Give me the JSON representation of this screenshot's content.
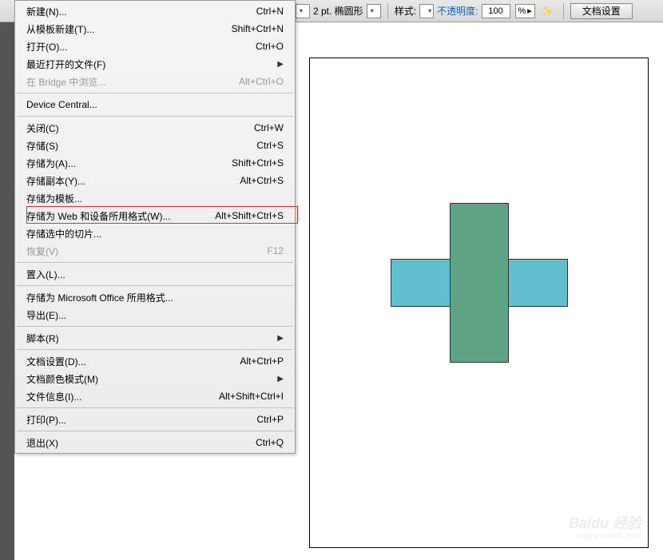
{
  "toolbar": {
    "stroke_val": "2 pt. 椭圆形",
    "style_label": "样式:",
    "opacity_label": "不透明度:",
    "opacity_value": "100",
    "opacity_unit": "%",
    "docset_btn": "文档设置"
  },
  "menu": {
    "items": [
      {
        "label": "新建(N)...",
        "shortcut": "Ctrl+N",
        "disabled": false
      },
      {
        "label": "从模板新建(T)...",
        "shortcut": "Shift+Ctrl+N",
        "disabled": false
      },
      {
        "label": "打开(O)...",
        "shortcut": "Ctrl+O",
        "disabled": false
      },
      {
        "label": "最近打开的文件(F)",
        "shortcut": "",
        "sub": true,
        "disabled": false
      },
      {
        "label": "在 Bridge 中浏览...",
        "shortcut": "Alt+Ctrl+O",
        "disabled": true
      }
    ],
    "device_central": "Device Central...",
    "items2": [
      {
        "label": "关闭(C)",
        "shortcut": "Ctrl+W",
        "disabled": false
      },
      {
        "label": "存储(S)",
        "shortcut": "Ctrl+S",
        "disabled": false
      },
      {
        "label": "存储为(A)...",
        "shortcut": "Shift+Ctrl+S",
        "disabled": false
      },
      {
        "label": "存储副本(Y)...",
        "shortcut": "Alt+Ctrl+S",
        "disabled": false
      },
      {
        "label": "存储为模板...",
        "shortcut": "",
        "disabled": false
      },
      {
        "label": "存储为 Web 和设备所用格式(W)...",
        "shortcut": "Alt+Shift+Ctrl+S",
        "disabled": false,
        "highlight": true
      },
      {
        "label": "存储选中的切片...",
        "shortcut": "",
        "disabled": false
      },
      {
        "label": "恢复(V)",
        "shortcut": "F12",
        "disabled": true
      }
    ],
    "place": "置入(L)...",
    "items3": [
      {
        "label": "存储为 Microsoft Office 所用格式...",
        "shortcut": "",
        "disabled": false
      },
      {
        "label": "导出(E)...",
        "shortcut": "",
        "disabled": false
      }
    ],
    "scripts": {
      "label": "脚本(R)",
      "sub": true
    },
    "items4": [
      {
        "label": "文档设置(D)...",
        "shortcut": "Alt+Ctrl+P",
        "disabled": false
      },
      {
        "label": "文档颜色模式(M)",
        "shortcut": "",
        "sub": true,
        "disabled": false
      },
      {
        "label": "文件信息(I)...",
        "shortcut": "Alt+Shift+Ctrl+I",
        "disabled": false
      }
    ],
    "print": {
      "label": "打印(P)...",
      "shortcut": "Ctrl+P"
    },
    "exit": {
      "label": "退出(X)",
      "shortcut": "Ctrl+Q"
    }
  },
  "watermark": {
    "brand": "Baidu 经验",
    "url": "jingyan.baidu.com"
  }
}
